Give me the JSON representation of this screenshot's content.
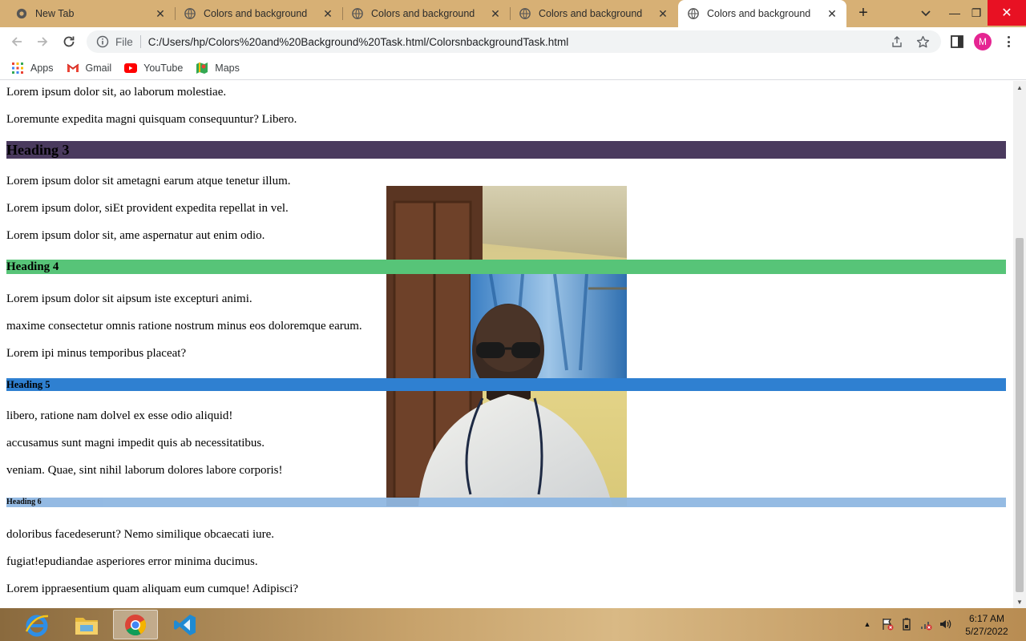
{
  "browser": {
    "tabs": [
      {
        "title": "New Tab",
        "active": false
      },
      {
        "title": "Colors and background",
        "active": false
      },
      {
        "title": "Colors and background",
        "active": false
      },
      {
        "title": "Colors and background",
        "active": false
      },
      {
        "title": "Colors and background",
        "active": true
      }
    ],
    "address": {
      "scheme": "File",
      "url": "C:/Users/hp/Colors%20and%20Background%20Task.html/ColorsnbackgroundTask.html"
    },
    "profile_initial": "M",
    "bookmarks": [
      {
        "label": "Apps",
        "icon": "apps-grid-icon"
      },
      {
        "label": "Gmail",
        "icon": "gmail-icon"
      },
      {
        "label": "YouTube",
        "icon": "youtube-icon"
      },
      {
        "label": "Maps",
        "icon": "maps-icon"
      }
    ]
  },
  "page": {
    "paragraphs": [
      "Lorem ipsum dolor sit, ao laborum molestiae.",
      "Loremunte expedita magni quisquam consequuntur? Libero.",
      "Lorem ipsum dolor sit ametagni earum atque tenetur illum.",
      "Lorem ipsum dolor, siEt provident expedita repellat in vel.",
      "Lorem ipsum dolor sit, ame aspernatur aut enim odio.",
      "Lorem ipsum dolor sit aipsum iste excepturi animi.",
      "maxime consectetur omnis ratione nostrum minus eos doloremque earum.",
      "Lorem ipi minus temporibus placeat?",
      "libero, ratione nam dolvel ex esse odio aliquid!",
      "accusamus sunt magni impedit quis ab necessitatibus.",
      "veniam. Quae, sint nihil laborum dolores labore corporis!",
      "doloribus facedeserunt? Nemo similique obcaecati iure.",
      "fugiat!epudiandae asperiores error minima ducimus.",
      "Lorem ippraesentium quam aliquam eum cumque! Adipisci?"
    ],
    "headings": [
      {
        "text": "Heading 3",
        "color": "#4a3a5e"
      },
      {
        "text": "Heading 4",
        "color": "#57c478"
      },
      {
        "text": "Heading 5",
        "color": "#2f80d1"
      },
      {
        "text": "Heading 6",
        "color": "#8fb7e2"
      }
    ]
  },
  "taskbar": {
    "apps": [
      "internet-explorer-icon",
      "file-explorer-icon",
      "chrome-icon",
      "vscode-icon"
    ],
    "time": "6:17 AM",
    "date": "5/27/2022"
  }
}
